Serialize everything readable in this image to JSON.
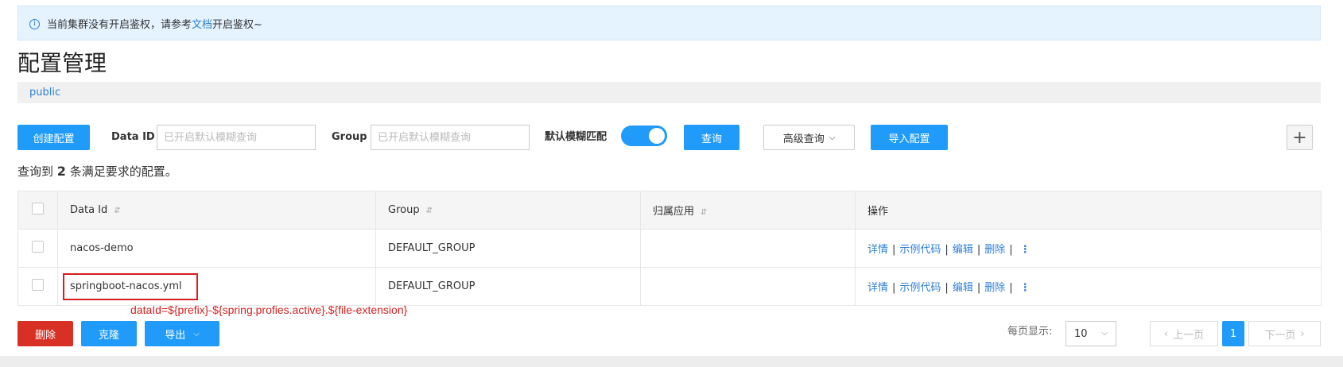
{
  "alert": {
    "icon": "info-icon",
    "text_before": "当前集群没有开启鉴权，请参考",
    "link": "文档",
    "text_after": "开启鉴权~"
  },
  "page_title": "配置管理",
  "namespace": "public",
  "toolbar": {
    "create_label": "创建配置",
    "data_id_label": "Data ID",
    "data_id_placeholder": "已开启默认模糊查询",
    "group_label": "Group",
    "group_placeholder": "已开启默认模糊查询",
    "fuzzy_label": "默认模糊匹配",
    "fuzzy_on": true,
    "query_label": "查询",
    "advanced_label": "高级查询",
    "import_label": "导入配置",
    "add_icon": "plus-icon"
  },
  "result": {
    "prefix": "查询到",
    "count": "2",
    "suffix": "条满足要求的配置。"
  },
  "table": {
    "headers": [
      "Data Id",
      "Group",
      "归属应用",
      "操作"
    ],
    "rows": [
      {
        "data_id": "nacos-demo",
        "group": "DEFAULT_GROUP",
        "app": ""
      },
      {
        "data_id": "springboot-nacos.yml",
        "group": "DEFAULT_GROUP",
        "app": ""
      }
    ],
    "ops": [
      "详情",
      "示例代码",
      "编辑",
      "删除"
    ]
  },
  "annotation": "dataId=${prefix}-${spring.profies.active}.${file-extension}",
  "footer": {
    "delete_label": "删除",
    "clone_label": "克隆",
    "export_label": "导出",
    "page_size_label": "每页显示:",
    "page_size": "10",
    "prev_label": "上一页",
    "next_label": "下一页",
    "current_page": "1"
  },
  "colors": {
    "primary": "#209bfa",
    "danger": "#d93026",
    "annotation": "#d62020"
  }
}
